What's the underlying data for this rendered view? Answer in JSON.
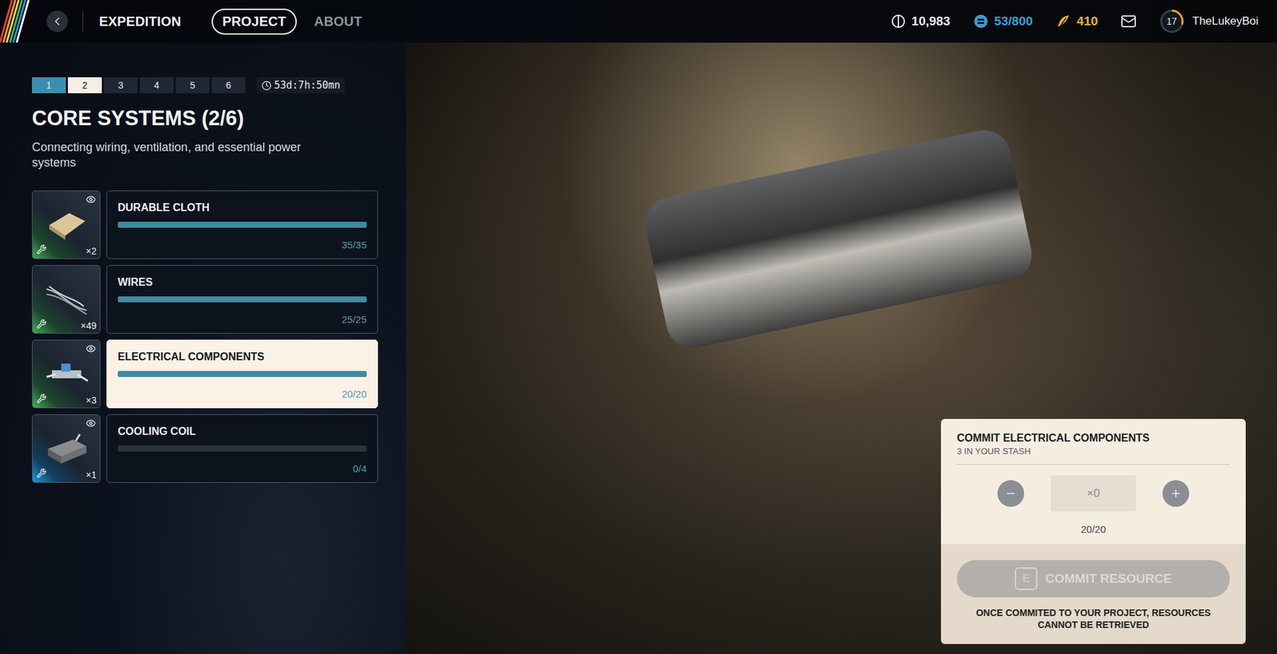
{
  "topbar": {
    "back": "‹",
    "nav": [
      {
        "label": "EXPEDITION",
        "selected": false,
        "kind": "title"
      },
      {
        "label": "PROJECT",
        "selected": true,
        "kind": "pill"
      },
      {
        "label": "ABOUT",
        "selected": false,
        "kind": "link"
      }
    ],
    "currencies": [
      {
        "value": "10,983",
        "color": "#e9edf2",
        "kind": "coins"
      },
      {
        "value": "53/800",
        "color": "#3d9bd6",
        "kind": "tokens"
      },
      {
        "value": "410",
        "color": "#e8b22a",
        "kind": "feathers"
      }
    ],
    "player": {
      "level": "17",
      "xp": 0.3,
      "name": "TheLukeyBoi"
    }
  },
  "steps": [
    {
      "label": "1",
      "selected": false,
      "completed": true
    },
    {
      "label": "2",
      "selected": true,
      "completed": false
    },
    {
      "label": "3",
      "selected": false,
      "completed": false
    },
    {
      "label": "4",
      "selected": false,
      "completed": false
    },
    {
      "label": "5",
      "selected": false,
      "completed": false
    },
    {
      "label": "6",
      "selected": false,
      "completed": false
    }
  ],
  "timer": "53d:7h:50mn",
  "title": "CORE SYSTEMS (2/6)",
  "description": "Connecting wiring, ventilation, and essential power systems",
  "items": [
    {
      "name": "DURABLE CLOTH",
      "count": "×2",
      "progress": "35/35",
      "level": 1,
      "selected": false,
      "watched": true,
      "color": "#3fae57",
      "kind": "cloth"
    },
    {
      "name": "WIRES",
      "count": "×49",
      "progress": "25/25",
      "level": 1,
      "selected": false,
      "watched": false,
      "color": "#3fae57",
      "kind": "wires"
    },
    {
      "name": "ELECTRICAL COMPONENTS",
      "count": "×3",
      "progress": "20/20",
      "level": 1,
      "selected": true,
      "watched": true,
      "color": "#3fae57",
      "kind": "component"
    },
    {
      "name": "COOLING COIL",
      "count": "×1",
      "progress": "0/4",
      "level": 0,
      "selected": false,
      "watched": true,
      "color": "#1e9be0",
      "kind": "coil"
    }
  ],
  "commit": {
    "title": "COMMIT ELECTRICAL COMPONENTS",
    "stash": "3 IN YOUR STASH",
    "quantity": "×0",
    "progress": "20/20",
    "key": "E",
    "button": "COMMIT RESOURCE",
    "disabled": true,
    "warning": "ONCE COMMITED TO YOUR PROJECT, RESOURCES CANNOT BE RETRIEVED"
  }
}
